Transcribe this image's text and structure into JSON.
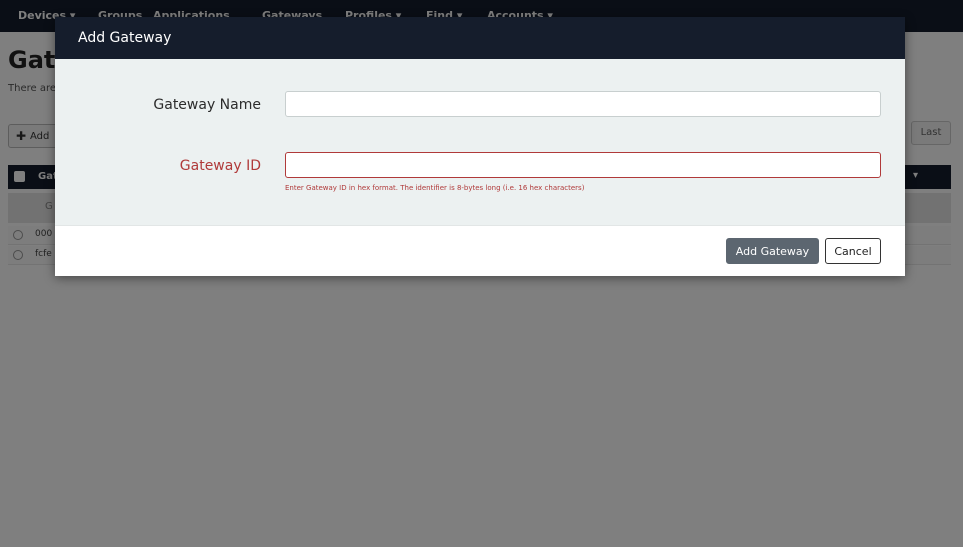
{
  "nav": {
    "items": [
      "Devices ▾",
      "Groups",
      "Applications",
      "Gateways",
      "Profiles ▾",
      "Find ▾",
      "Accounts ▾"
    ]
  },
  "page": {
    "title": "Gat",
    "subtitle": "There are",
    "add_button": "Add",
    "last_button": "Last",
    "table_header_label": "Gat",
    "filter_placeholder": "G",
    "rows": [
      "000",
      "fcfe"
    ]
  },
  "modal": {
    "title": "Add Gateway",
    "gateway_name": {
      "label": "Gateway Name",
      "value": "",
      "placeholder": ""
    },
    "gateway_id": {
      "label": "Gateway ID",
      "value": "",
      "placeholder": "",
      "help": "Enter Gateway ID in hex format. The identifier is 8-bytes long (i.e. 16 hex characters)"
    },
    "submit_label": "Add Gateway",
    "cancel_label": "Cancel"
  },
  "colors": {
    "navbar": "#151d2c",
    "error": "#b03a3a",
    "primary_button": "#5c6670",
    "modal_body": "#ecf1f1"
  }
}
